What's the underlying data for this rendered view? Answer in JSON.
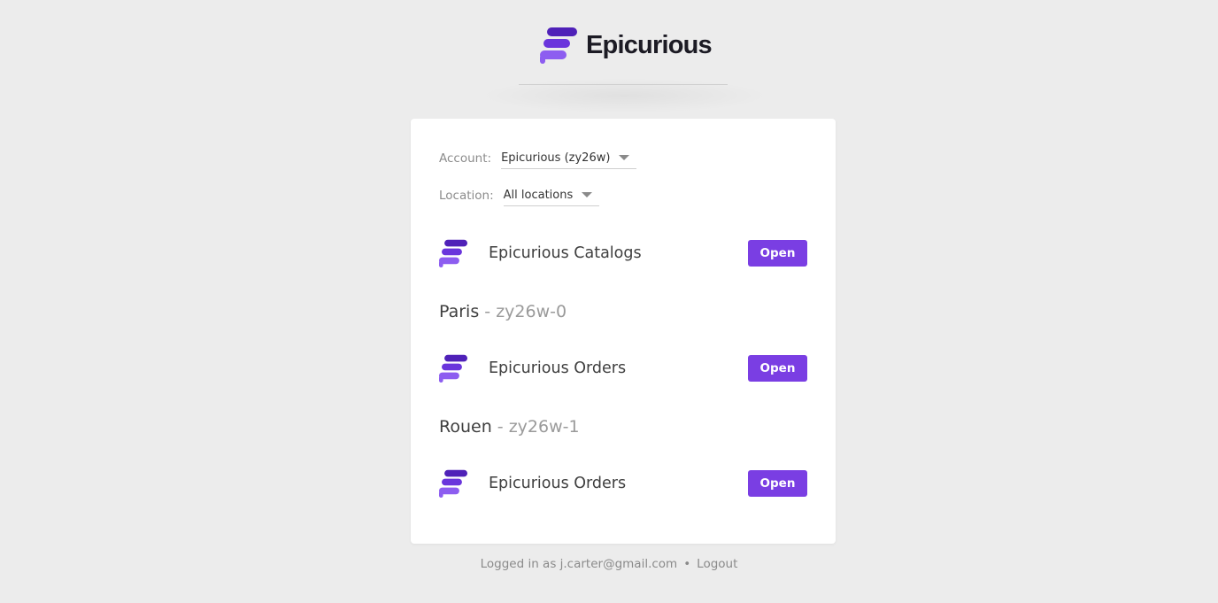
{
  "brand": {
    "name": "Epicurious",
    "logo_icon": "epicurious-logo-icon",
    "accent_dark": "#4f21b8",
    "accent_light": "#8d5df0"
  },
  "filters": {
    "account_label": "Account:",
    "account_value": "Epicurious (zy26w)",
    "location_label": "Location:",
    "location_value": "All locations"
  },
  "apps": {
    "catalogs": {
      "name": "Epicurious Catalogs",
      "button": "Open"
    }
  },
  "locations": [
    {
      "name": "Paris",
      "separator": " - ",
      "code": "zy26w-0",
      "app": {
        "name": "Epicurious Orders",
        "button": "Open"
      }
    },
    {
      "name": "Rouen",
      "separator": " - ",
      "code": "zy26w-1",
      "app": {
        "name": "Epicurious Orders",
        "button": "Open"
      }
    }
  ],
  "footer": {
    "logged_in_text": "Logged in as j.carter@gmail.com",
    "separator": "•",
    "logout_label": "Logout"
  },
  "colors": {
    "button": "#7a3ee3",
    "background": "#ececec",
    "card": "#ffffff"
  }
}
